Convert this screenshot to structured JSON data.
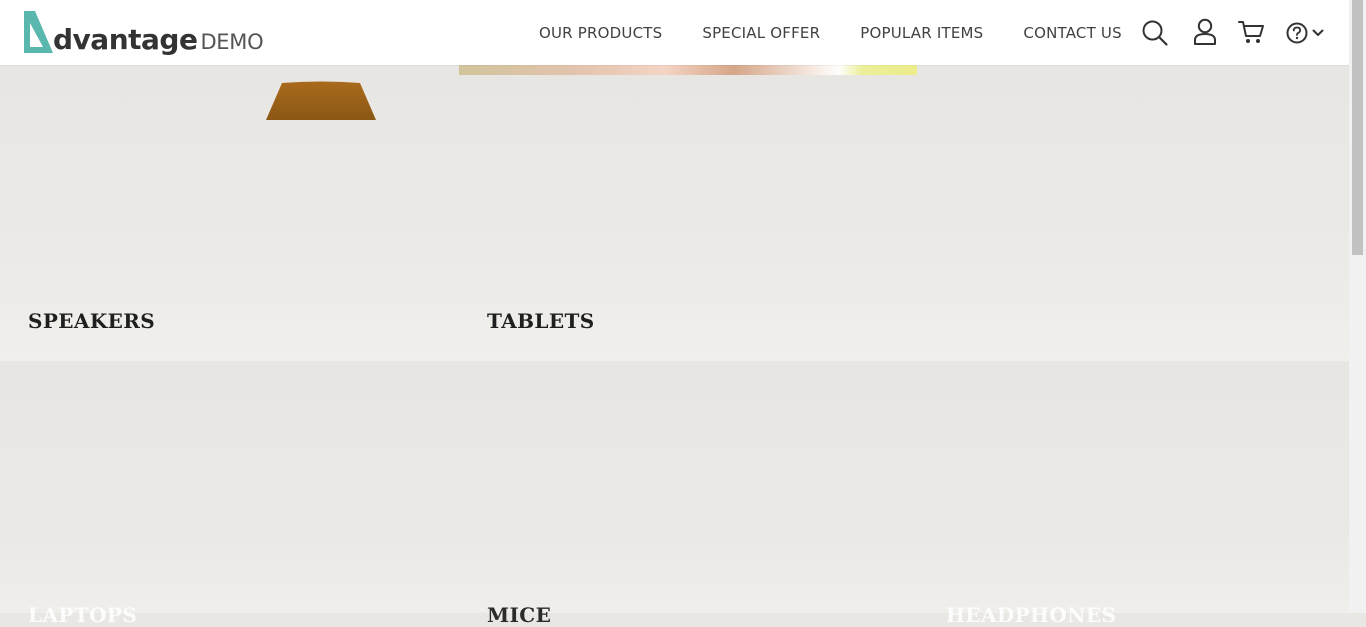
{
  "header": {
    "logo": {
      "brand": "dvantage",
      "demo": "DEMO",
      "accent_color": "#5ab7ae"
    },
    "nav": [
      {
        "label": "OUR PRODUCTS"
      },
      {
        "label": "SPECIAL OFFER"
      },
      {
        "label": "POPULAR ITEMS"
      },
      {
        "label": "CONTACT US"
      }
    ],
    "icons": [
      "search-icon",
      "user-icon",
      "cart-icon",
      "help-icon",
      "chevron-down-icon"
    ]
  },
  "categories": {
    "speakers": "SPEAKERS",
    "tablets": "TABLETS",
    "laptops": "LAPTOPS",
    "mice": "MICE",
    "headphones": "HEADPHONES"
  },
  "colors": {
    "page_bg": "#e9e7e3",
    "header_bg": "#ffffff",
    "text": "#414141"
  }
}
